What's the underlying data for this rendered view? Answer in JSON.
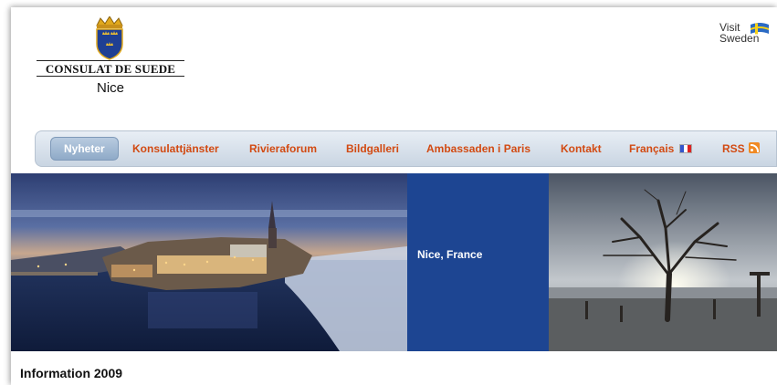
{
  "header": {
    "title": "CONSULAT DE SUEDE",
    "city": "Nice",
    "visit_sweden": {
      "line1": "Visit",
      "line2": "Sweden"
    }
  },
  "nav": {
    "items": [
      {
        "label": "Nyheter",
        "active": true
      },
      {
        "label": "Konsulattjänster"
      },
      {
        "label": "Rivieraforum"
      },
      {
        "label": "Bildgalleri"
      },
      {
        "label": "Ambassaden i Paris"
      },
      {
        "label": "Kontakt"
      },
      {
        "label": "Français",
        "icon": "french-flag-icon"
      },
      {
        "label": "RSS",
        "icon": "rss-icon"
      }
    ]
  },
  "banner": {
    "caption": "Nice, France",
    "left_image": "stockholm-evening-photo",
    "right_image": "winter-tree-photo"
  },
  "main": {
    "heading": "Information 2009"
  },
  "colors": {
    "nav_text": "#d24a12",
    "caption_bg": "#1d4592",
    "active_tab": "#8faac8"
  }
}
